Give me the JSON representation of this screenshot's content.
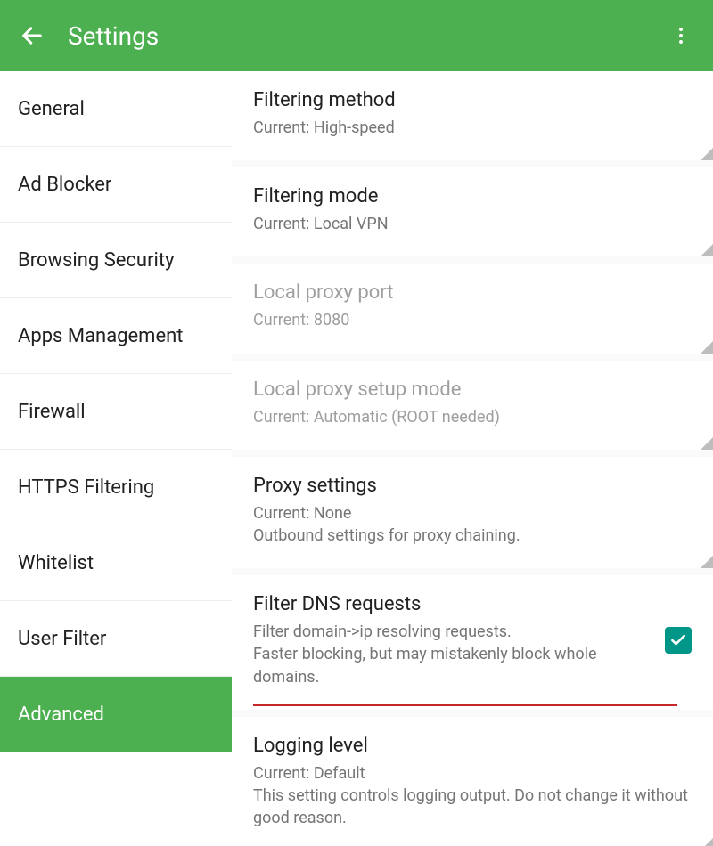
{
  "header": {
    "title": "Settings"
  },
  "sidebar": {
    "items": [
      {
        "label": "General"
      },
      {
        "label": "Ad Blocker"
      },
      {
        "label": "Browsing Security"
      },
      {
        "label": "Apps Management"
      },
      {
        "label": "Firewall"
      },
      {
        "label": "HTTPS Filtering"
      },
      {
        "label": "Whitelist"
      },
      {
        "label": "User Filter"
      },
      {
        "label": "Advanced"
      }
    ]
  },
  "content": {
    "filtering_method": {
      "title": "Filtering method",
      "sub": "Current: High-speed"
    },
    "filtering_mode": {
      "title": "Filtering mode",
      "sub": "Current: Local VPN"
    },
    "local_proxy_port": {
      "title": "Local proxy port",
      "sub": "Current: 8080"
    },
    "local_proxy_setup": {
      "title": "Local proxy setup mode",
      "sub": "Current: Automatic (ROOT needed)"
    },
    "proxy_settings": {
      "title": "Proxy settings",
      "sub1": "Current: None",
      "sub2": "Outbound settings for proxy chaining."
    },
    "filter_dns": {
      "title": "Filter DNS requests",
      "sub1": "Filter domain->ip resolving requests.",
      "sub2": "Faster blocking, but may mistakenly block whole domains.",
      "checked": true
    },
    "logging_level": {
      "title": "Logging level",
      "sub1": "Current: Default",
      "sub2": "This setting controls logging output. Do not change it without good reason."
    }
  }
}
